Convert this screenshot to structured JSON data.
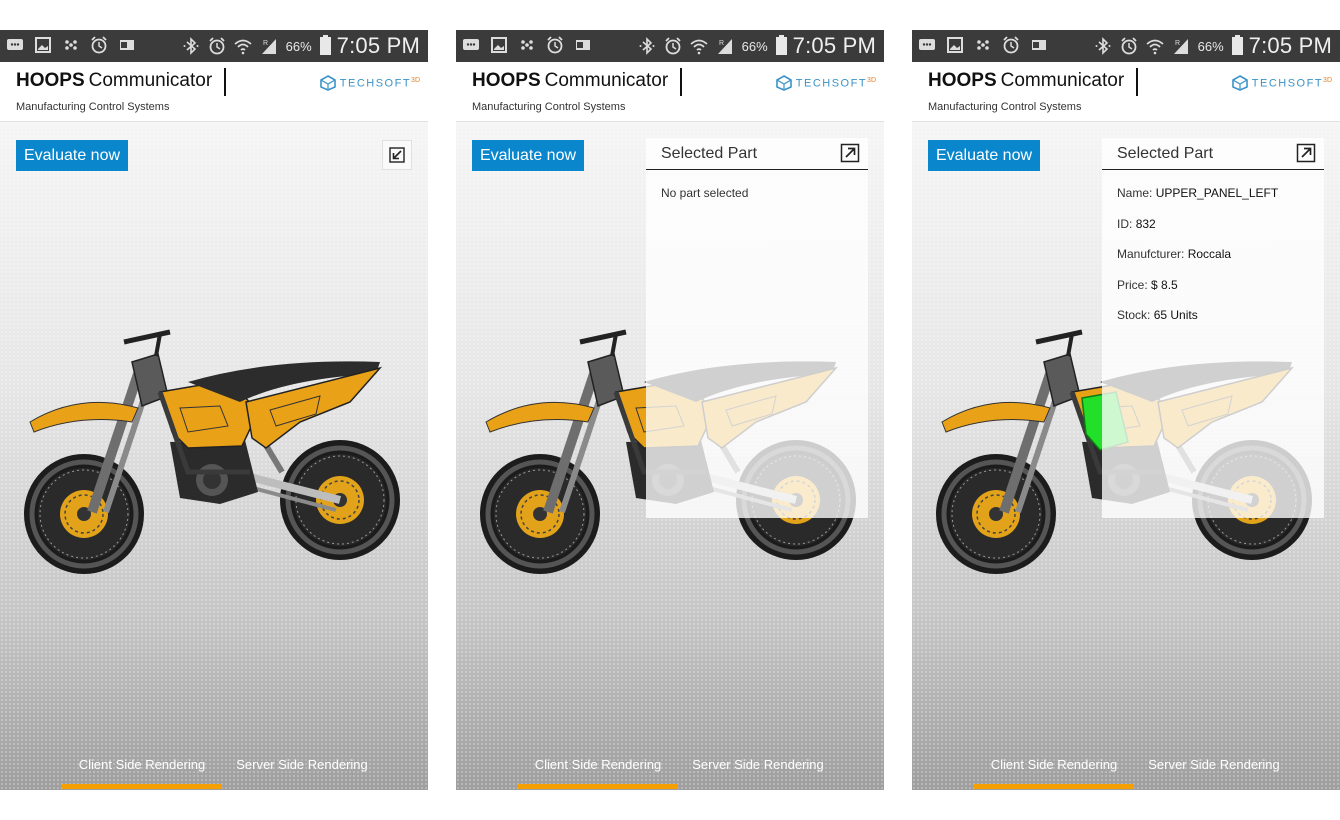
{
  "status_bar": {
    "icons": [
      "message-icon",
      "image-icon",
      "dots-icon",
      "alarm-icon",
      "outlook-icon"
    ],
    "right_icons": [
      "bluetooth-icon",
      "alarm-icon",
      "wifi-icon",
      "signal-icon",
      "battery-icon"
    ],
    "battery": "66%",
    "time": "7:05 PM"
  },
  "header": {
    "brand_bold": "HOOPS",
    "brand_rest": "Communicator",
    "subtitle": "Manufacturing Control Systems",
    "logo_text": "TECHSOFT",
    "logo_suffix": "3D"
  },
  "viewport": {
    "evaluate_label": "Evaluate now",
    "accent_color": "#0a86cc",
    "highlight_color": "#22e02a",
    "bike_color": "#f0a818"
  },
  "screens": [
    {
      "panel_open": false,
      "highlight": false
    },
    {
      "panel_open": true,
      "highlight": false,
      "panel": {
        "title": "Selected Part",
        "empty_text": "No part selected"
      }
    },
    {
      "panel_open": true,
      "highlight": true,
      "panel": {
        "title": "Selected Part",
        "rows": [
          {
            "label": "Name:",
            "value": "UPPER_PANEL_LEFT"
          },
          {
            "label": "ID:",
            "value": "832"
          },
          {
            "label": "Manufcturer:",
            "value": "Roccala"
          },
          {
            "label": "Price:",
            "value": "$ 8.5"
          },
          {
            "label": "Stock:",
            "value": "65 Units"
          }
        ]
      }
    }
  ],
  "tabs": {
    "client": "Client Side Rendering",
    "server": "Server Side Rendering",
    "active": "client",
    "underline_color": "#f5a000"
  }
}
